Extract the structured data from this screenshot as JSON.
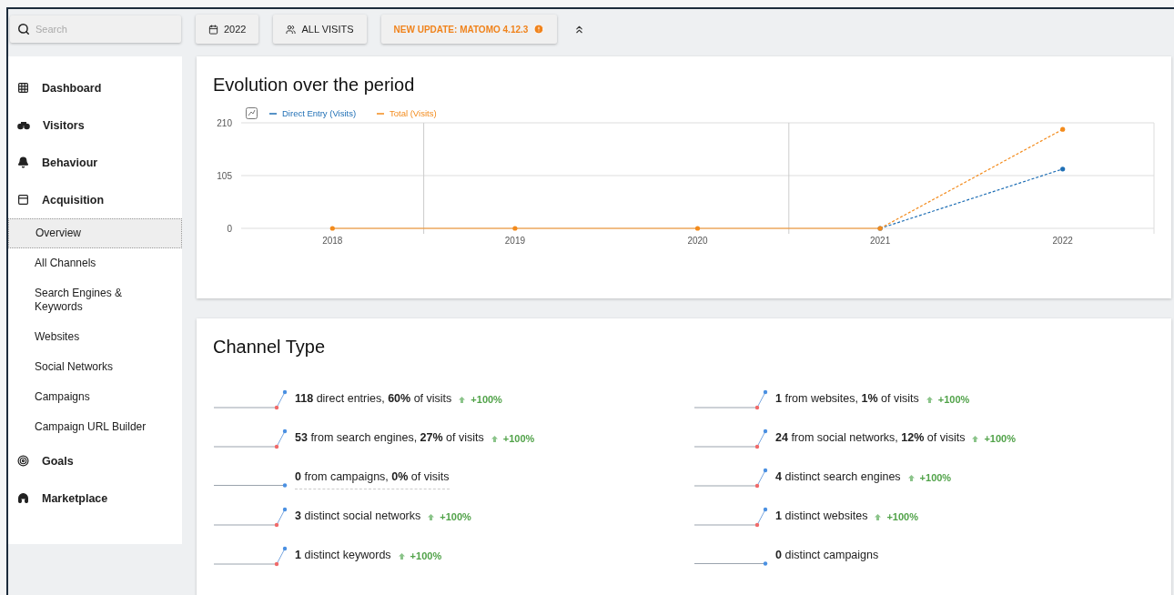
{
  "topbar": {
    "search": {
      "placeholder": "Search"
    },
    "buttons": [
      {
        "kind": "period",
        "label": "2022"
      },
      {
        "kind": "segment",
        "label": "ALL VISITS"
      },
      {
        "kind": "update",
        "label": "NEW UPDATE: MATOMO 4.12.3"
      }
    ]
  },
  "sidebar": {
    "items": [
      {
        "label": "Dashboard",
        "selected": false
      },
      {
        "label": "Visitors",
        "selected": false
      },
      {
        "label": "Behaviour",
        "selected": false
      },
      {
        "label": "Acquisition",
        "selected": false,
        "expanded": true,
        "children": [
          {
            "label": "Overview",
            "selected": true
          },
          {
            "label": "All Channels",
            "selected": false
          },
          {
            "label": "Search Engines & Keywords",
            "selected": false
          },
          {
            "label": "Websites",
            "selected": false
          },
          {
            "label": "Social Networks",
            "selected": false
          },
          {
            "label": "Campaigns",
            "selected": false
          },
          {
            "label": "Campaign URL Builder",
            "selected": false
          }
        ]
      },
      {
        "label": "Goals",
        "selected": false
      },
      {
        "label": "Marketplace",
        "selected": false
      }
    ]
  },
  "evolution": {
    "title": "Evolution over the period",
    "chart_data": {
      "type": "line",
      "legend": "top",
      "ref_lines": [
        {
          "axis": "y",
          "value": 105
        }
      ],
      "categories": [
        "2018",
        "2019",
        "2020",
        "2021",
        "2022"
      ],
      "ylim": [
        0,
        210
      ],
      "yticks": [
        0,
        105,
        210
      ],
      "series": [
        {
          "name": "Direct Entry (Visits)",
          "color": "#1f6fb5",
          "line_style": "dashed",
          "values": [
            null,
            null,
            null,
            0,
            118
          ]
        },
        {
          "name": "Total (Visits)",
          "color": "#f38b1c",
          "line_style": "solid_last_dashed",
          "values": [
            0,
            0,
            0,
            0,
            197
          ]
        }
      ]
    }
  },
  "channel_type": {
    "title": "Channel Type",
    "metrics": [
      {
        "text": "**118** direct entries, **60%** of visits",
        "kind": "rising",
        "change": "+100%",
        "hovered": false
      },
      {
        "text": "**53** from search engines, **27%** of visits",
        "kind": "rising",
        "change": "+100%",
        "hovered": false
      },
      {
        "text": "**0** from campaigns, **0%** of visits",
        "kind": "flat",
        "hovered": true
      },
      {
        "text": "**3** distinct social networks",
        "kind": "rising",
        "change": "+100%",
        "hovered": false
      },
      {
        "text": "**1** distinct keywords",
        "kind": "rising",
        "change": "+100%",
        "hovered": false
      },
      {
        "text": "**1** from websites, **1%** of visits",
        "kind": "rising",
        "change": "+100%",
        "hovered": false
      },
      {
        "text": "**24** from social networks, **12%** of visits",
        "kind": "rising",
        "change": "+100%",
        "hovered": false
      },
      {
        "text": "**4** distinct search engines",
        "kind": "rising",
        "change": "+100%",
        "hovered": false
      },
      {
        "text": "**1** distinct websites",
        "kind": "rising",
        "change": "+100%",
        "hovered": false
      },
      {
        "text": "**0** distinct campaigns",
        "kind": "flat",
        "hovered": false
      }
    ]
  }
}
